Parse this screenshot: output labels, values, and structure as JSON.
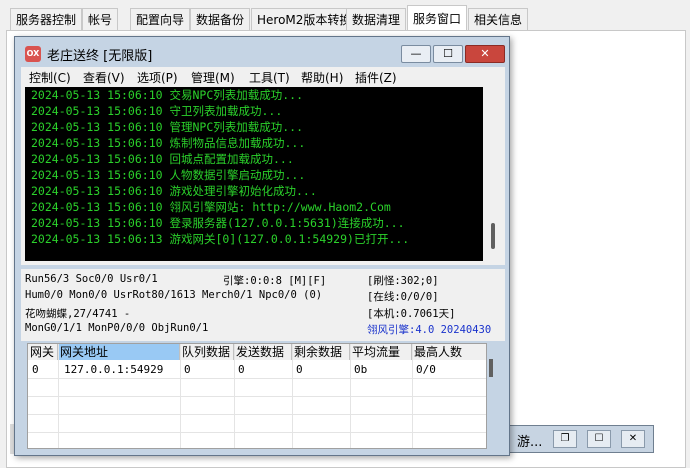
{
  "outer_tabs": [
    "服务器控制",
    "帐号",
    "配置向导",
    "数据备份",
    "HeroM2版本转换",
    "数据清理",
    "服务窗口",
    "相关信息"
  ],
  "active_outer_tab": "服务窗口",
  "window": {
    "icon_text": "OX",
    "title": "老庄送终 [无限版]",
    "min_glyph": "—",
    "max_glyph": "☐",
    "close_glyph": "✕"
  },
  "menu": [
    "控制(C)",
    "查看(V)",
    "选项(P)",
    "管理(M)",
    "工具(T)",
    "帮助(H)",
    "插件(Z)"
  ],
  "log_lines": [
    "2024-05-13 15:06:10 交易NPC列表加载成功...",
    "2024-05-13 15:06:10 守卫列表加载成功...",
    "2024-05-13 15:06:10 管理NPC列表加载成功...",
    "2024-05-13 15:06:10 炼制物品信息加载成功...",
    "2024-05-13 15:06:10 回城点配置加载成功...",
    "2024-05-13 15:06:10 人物数据引擎启动成功...",
    "2024-05-13 15:06:10 游戏处理引擎初始化成功...",
    "2024-05-13 15:06:10 翎风引擎网站: http://www.Haom2.Com",
    "2024-05-13 15:06:10 登录服务器(127.0.0.1:5631)连接成功...",
    "2024-05-13 15:06:13 游戏网关[0](127.0.0.1:54929)已打开..."
  ],
  "status": {
    "run": "Run56/3 Soc0/0 Usr0/1",
    "engine": "引擎:0:0:8 [M][F]",
    "refresh": "[刷怪:302;0]",
    "hum": "Hum0/0 Mon0/0 UsrRot80/1613 Merch0/1 Npc0/0 (0)",
    "online": "[在线:0/0/0]",
    "map": "花吻蝴蝶,27/4741 -",
    "version_local": "[本机:0.7061天]",
    "mon": "MonG0/1/1 MonP0/0/0 ObjRun0/1",
    "engine_version": "翎风引擎:4.0 20240430"
  },
  "grid": {
    "headers": [
      "网关",
      "网关地址",
      "队列数据",
      "发送数据",
      "剩余数据",
      "平均流量",
      "最高人数"
    ],
    "rows": [
      [
        "0",
        "127.0.0.1:54929",
        "0",
        "0",
        "0",
        "0b",
        "0/0"
      ]
    ]
  },
  "bg_window": {
    "title": "游...",
    "restore_glyph": "❐",
    "max_glyph": "☐",
    "close_glyph": "✕"
  }
}
